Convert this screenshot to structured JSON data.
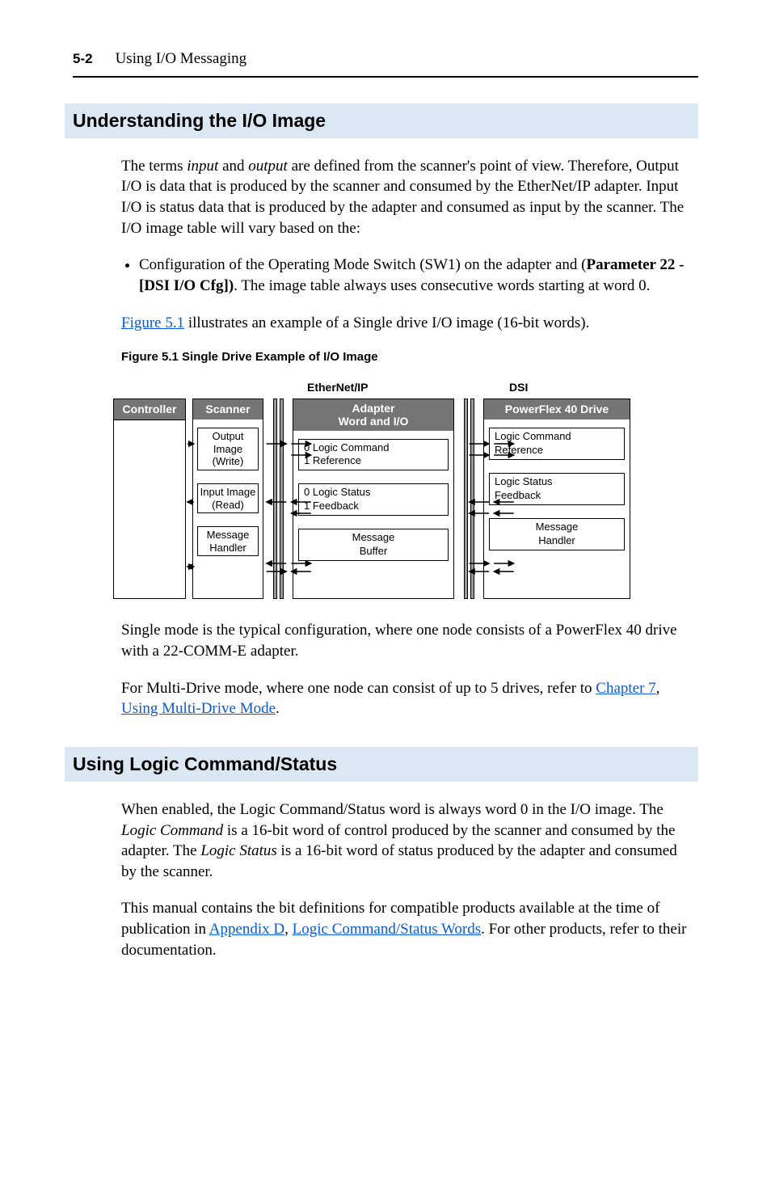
{
  "header": {
    "page_number": "5-2",
    "section_title": "Using I/O Messaging"
  },
  "section1": {
    "heading": "Understanding the I/O Image",
    "para1_a": "The terms ",
    "para1_i1": "input",
    "para1_b": " and ",
    "para1_i2": "output",
    "para1_c": " are defined from the scanner's point of view. Therefore, Output I/O is data that is produced by the scanner and consumed by the EtherNet/IP adapter. Input I/O is status data that is produced by the adapter and consumed as input by the scanner. The I/O image table will vary based on the:",
    "bullet1_a": "Configuration of the Operating Mode Switch (SW1) on the adapter and (",
    "bullet1_bold": "Parameter 22 - [DSI I/O Cfg])",
    "bullet1_b": ". The image table always uses consecutive words starting at word 0.",
    "para2_link": "Figure 5.1",
    "para2_rest": " illustrates an example of a Single drive I/O image (16-bit words).",
    "fig_caption": "Figure 5.1   Single Drive Example of I/O Image"
  },
  "diagram": {
    "label_ethernet": "EtherNet/IP",
    "label_dsi": "DSI",
    "controller_title": "Controller",
    "scanner_title": "Scanner",
    "scanner_boxes": [
      "Output Image (Write)",
      "Input Image (Read)",
      "Message Handler"
    ],
    "adapter_title": "Adapter\nWord and I/O",
    "adapter_boxes": [
      "0 Logic Command\n1 Reference",
      "0 Logic Status\n1 Feedback",
      "Message\nBuffer"
    ],
    "drive_title": "PowerFlex 40 Drive",
    "drive_boxes": [
      "Logic Command\nReference",
      "Logic Status\nFeedback",
      "Message\nHandler"
    ]
  },
  "section1b": {
    "para3": "Single mode is the typical configuration, where one node consists of a PowerFlex 40 drive with a 22-COMM-E adapter.",
    "para4_a": "For Multi-Drive mode, where one node can consist of up to 5 drives, refer to ",
    "para4_link1": "Chapter 7",
    "para4_mid": ", ",
    "para4_link2": "Using Multi-Drive Mode",
    "para4_end": "."
  },
  "section2": {
    "heading": "Using Logic Command/Status",
    "para1_a": "When enabled, the Logic Command/Status word is always word 0 in the I/O image. The ",
    "para1_i1": "Logic Command",
    "para1_b": " is a 16-bit word of control produced by the scanner and consumed by the adapter. The ",
    "para1_i2": "Logic Status",
    "para1_c": " is a 16-bit word of status produced by the adapter and consumed by the scanner.",
    "para2_a": "This manual contains the bit definitions for compatible products available at the time of publication in ",
    "para2_link1": "Appendix D",
    "para2_mid": ", ",
    "para2_link2": "Logic Command/Status Words",
    "para2_b": ". For other products, refer to their documentation."
  }
}
